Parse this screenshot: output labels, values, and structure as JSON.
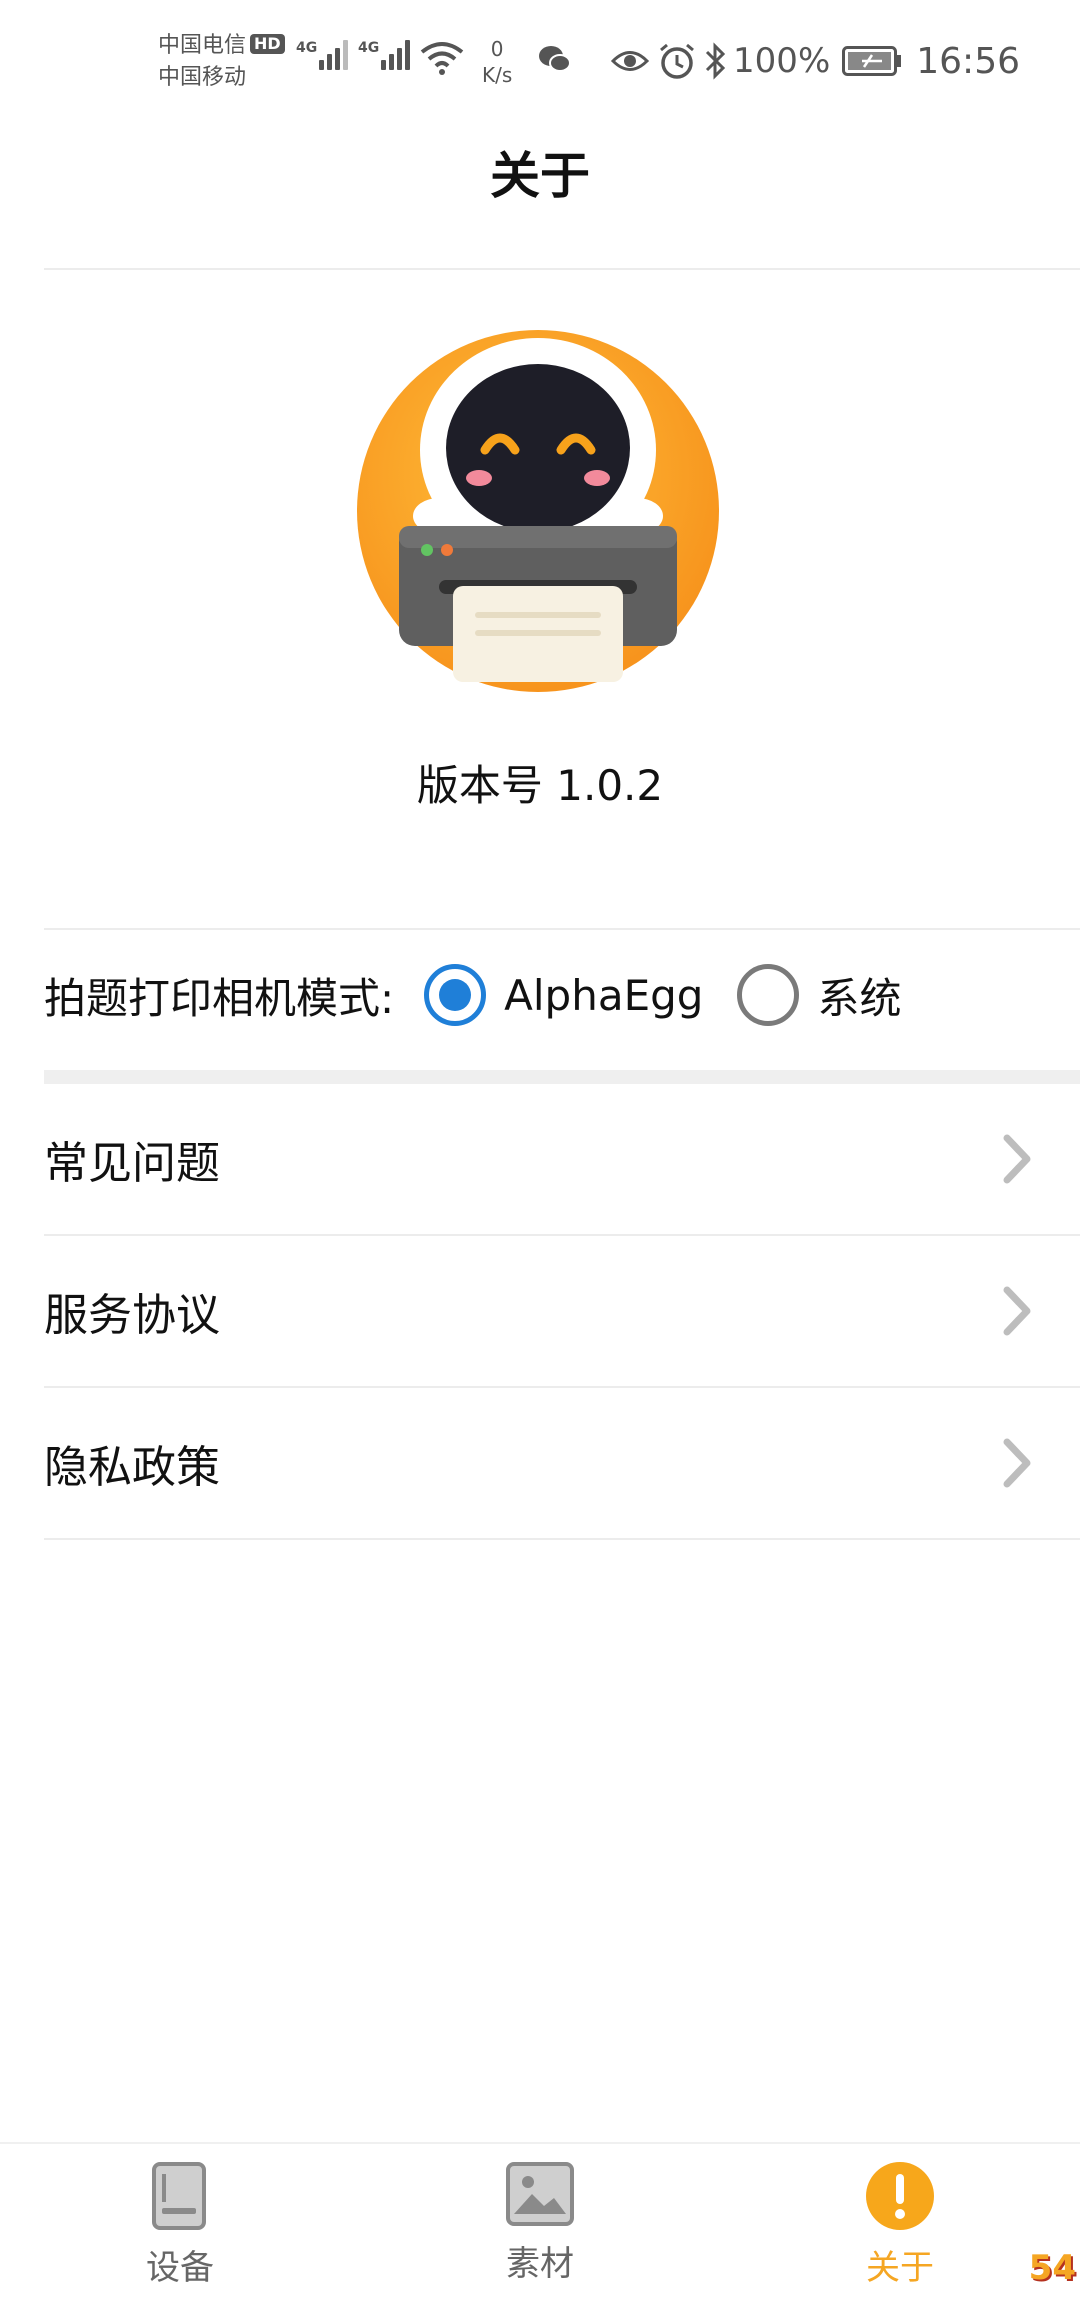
{
  "status_bar": {
    "carrier1": "中国电信",
    "carrier1_badge": "HD",
    "carrier2": "中国移动",
    "sig1_label": "4G",
    "sig2_label": "4G",
    "netspeed_value": "0",
    "netspeed_unit": "K/s",
    "battery_percent": "100%",
    "time": "16:56",
    "icons": [
      "signal-icon",
      "wifi-icon",
      "wechat-icon",
      "eye-icon",
      "alarm-icon",
      "bluetooth-icon",
      "battery-icon"
    ]
  },
  "header": {
    "title": "关于"
  },
  "about": {
    "version": "版本号 1.0.2"
  },
  "camera_mode": {
    "label": "拍题打印相机模式:",
    "options": [
      {
        "label": "AlphaEgg",
        "selected": true
      },
      {
        "label": "系统",
        "selected": false
      }
    ]
  },
  "menu": [
    {
      "label": "常见问题"
    },
    {
      "label": "服务协议"
    },
    {
      "label": "隐私政策"
    }
  ],
  "bottom_nav": {
    "items": [
      {
        "label": "设备",
        "icon": "device-icon",
        "active": false
      },
      {
        "label": "素材",
        "icon": "image-icon",
        "active": false
      },
      {
        "label": "关于",
        "icon": "info-icon",
        "active": true
      }
    ]
  },
  "watermark": "54"
}
